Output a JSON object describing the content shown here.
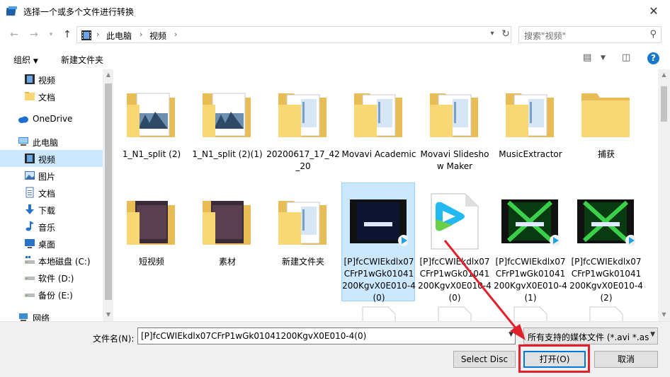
{
  "window": {
    "title": "选择一个或多个文件进行转换"
  },
  "address": {
    "crumbs": [
      "此电脑",
      "视频"
    ],
    "search_placeholder": "搜索\"视频\""
  },
  "toolbar": {
    "organize": "组织",
    "new_folder": "新建文件夹"
  },
  "sidebar": {
    "items": [
      {
        "label": "视频",
        "icon": "video-folder-icon"
      },
      {
        "label": "文档",
        "icon": "folder-icon"
      },
      {
        "label": "OneDrive",
        "icon": "cloud-icon"
      },
      {
        "label": "此电脑",
        "icon": "computer-icon"
      },
      {
        "label": "视频",
        "icon": "video-folder-icon",
        "selected": true
      },
      {
        "label": "图片",
        "icon": "pictures-icon"
      },
      {
        "label": "文档",
        "icon": "documents-icon"
      },
      {
        "label": "下载",
        "icon": "download-icon"
      },
      {
        "label": "音乐",
        "icon": "music-icon"
      },
      {
        "label": "桌面",
        "icon": "desktop-icon"
      },
      {
        "label": "本地磁盘 (C:)",
        "icon": "drive-c-icon"
      },
      {
        "label": "软件 (D:)",
        "icon": "drive-icon"
      },
      {
        "label": "备份 (E:)",
        "icon": "drive-icon"
      },
      {
        "label": "网络",
        "icon": "network-icon"
      }
    ]
  },
  "files": [
    {
      "label": "1_N1_split (2)",
      "kind": "folder-image"
    },
    {
      "label": "1_N1_split (2)(1)",
      "kind": "folder-image"
    },
    {
      "label": "20200617_17_42_20",
      "kind": "folder-doc"
    },
    {
      "label": "Movavi Academic",
      "kind": "folder-doc"
    },
    {
      "label": "Movavi Slideshow Maker",
      "kind": "folder-doc"
    },
    {
      "label": "MusicExtractor",
      "kind": "folder-doc"
    },
    {
      "label": "捕获",
      "kind": "folder"
    },
    {
      "label": "短视频",
      "kind": "folder-video"
    },
    {
      "label": "素材",
      "kind": "folder-video"
    },
    {
      "label": "新建文件夹",
      "kind": "folder-doc"
    },
    {
      "label": "[P]fcCWIEkdlx07CFrP1wGk01041200KgvX0E010-4(0)",
      "kind": "video-dark",
      "selected": true
    },
    {
      "label": "[P]fcCWIEkdlx07CFrP1wGk01041200KgvX0E010-4(0)",
      "kind": "mp4"
    },
    {
      "label": "[P]fcCWIEkdlx07CFrP1wGk01041200KgvX0E010-4(1)",
      "kind": "video-green"
    },
    {
      "label": "[P]fcCWIEkdlx07CFrP1wGk01041200KgvX0E010-4(2)",
      "kind": "video-green"
    }
  ],
  "bottom": {
    "filename_label": "文件名(N):",
    "filename_value": "[P]fcCWIEkdlx07CFrP1wGk01041200KgvX0E010-4(0)",
    "filter_value": "所有支持的媒体文件 (*.avi *.as",
    "select_disc": "Select Disc",
    "open": "打开(O)",
    "cancel": "取消"
  },
  "colors": {
    "selection": "#cce8ff",
    "accent": "#0078d7",
    "annotation": "#e0202a",
    "folder": "#f8d775"
  }
}
